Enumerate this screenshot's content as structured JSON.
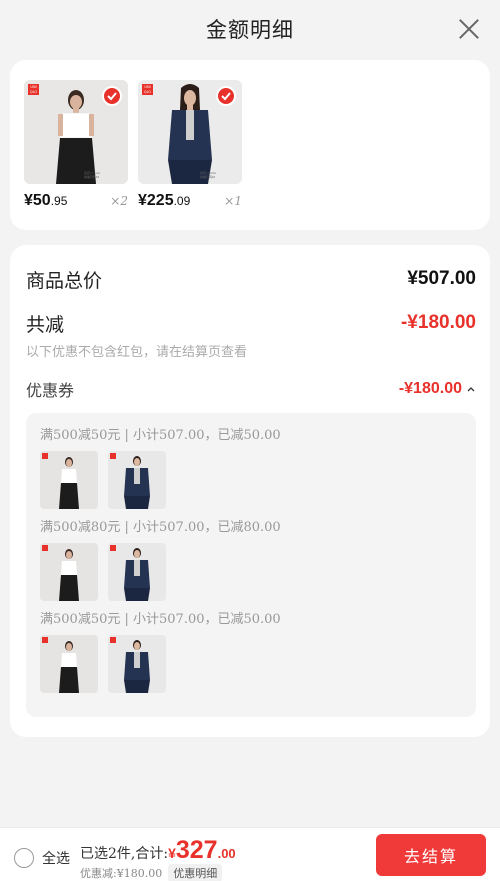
{
  "header": {
    "title": "金额明细"
  },
  "products": [
    {
      "price_int": "¥50",
      "price_dec": ".95",
      "qty": "×2",
      "image": "white-tshirt-black-pants-model",
      "selected": true,
      "brand_badge": "UNI QLO"
    },
    {
      "price_int": "¥225",
      "price_dec": ".09",
      "qty": "×1",
      "image": "navy-denim-jacket-model",
      "selected": true,
      "brand_badge": "UNI QLO"
    }
  ],
  "detail": {
    "total_label": "商品总价",
    "total_value": "¥507.00",
    "discount_label": "共减",
    "discount_value": "-¥180.00",
    "discount_note": "以下优惠不包含红包，请在结算页查看",
    "coupon_label": "优惠券",
    "coupon_value": "-¥180.00",
    "coupon_groups": [
      {
        "title": "满500减50元 | 小计507.00，已减50.00",
        "thumbs": [
          "white-tshirt-model",
          "denim-jacket-model"
        ]
      },
      {
        "title": "满500减80元 | 小计507.00，已减80.00",
        "thumbs": [
          "white-tshirt-model",
          "denim-jacket-model"
        ]
      },
      {
        "title": "满500减50元 | 小计507.00，已减50.00",
        "thumbs": [
          "white-tshirt-model",
          "denim-jacket-model"
        ]
      }
    ]
  },
  "bottom": {
    "select_all": "全选",
    "summary_prefix": "已选2件,合计:",
    "currency": "¥",
    "total_int": "327",
    "total_dec": ".00",
    "discount_text": "优惠减:¥180.00",
    "detail_btn": "优惠明细",
    "checkout": "去结算"
  },
  "colors": {
    "accent": "#e8312a",
    "checkout_bg": "#f03a3a"
  }
}
